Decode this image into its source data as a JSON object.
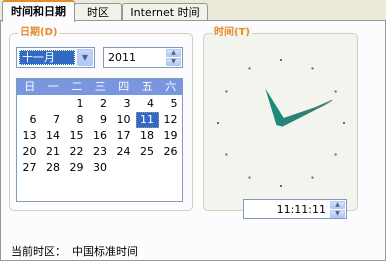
{
  "tabs": [
    {
      "label": "时间和日期",
      "active": true
    },
    {
      "label": "时区",
      "active": false
    },
    {
      "label": "Internet 时间",
      "active": false
    }
  ],
  "date_group": {
    "legend": "日期(D)",
    "month": "十一月",
    "year": "2011",
    "weekdays": [
      "日",
      "一",
      "二",
      "三",
      "四",
      "五",
      "六"
    ],
    "days": [
      [
        "",
        "",
        "1",
        "2",
        "3",
        "4",
        "5"
      ],
      [
        "6",
        "7",
        "8",
        "9",
        "10",
        "11",
        "12"
      ],
      [
        "13",
        "14",
        "15",
        "16",
        "17",
        "18",
        "19"
      ],
      [
        "20",
        "21",
        "22",
        "23",
        "24",
        "25",
        "26"
      ],
      [
        "27",
        "28",
        "29",
        "30",
        "",
        "",
        ""
      ],
      [
        "",
        "",
        "",
        "",
        "",
        "",
        ""
      ]
    ],
    "selected_day": "11"
  },
  "time_group": {
    "legend": "时间(T)",
    "time_value": "11:11:11"
  },
  "timezone": {
    "label": "当前时区：",
    "value": "中国标准时间"
  },
  "colors": {
    "accent_orange": "#E68B2C",
    "calendar_header": "#7A96DF",
    "selection": "#316AC5",
    "clock_hand": "#1B8A7A"
  },
  "icons": {
    "dropdown": "chevron-down-icon",
    "spin_up": "arrow-up-icon",
    "spin_down": "arrow-down-icon"
  }
}
